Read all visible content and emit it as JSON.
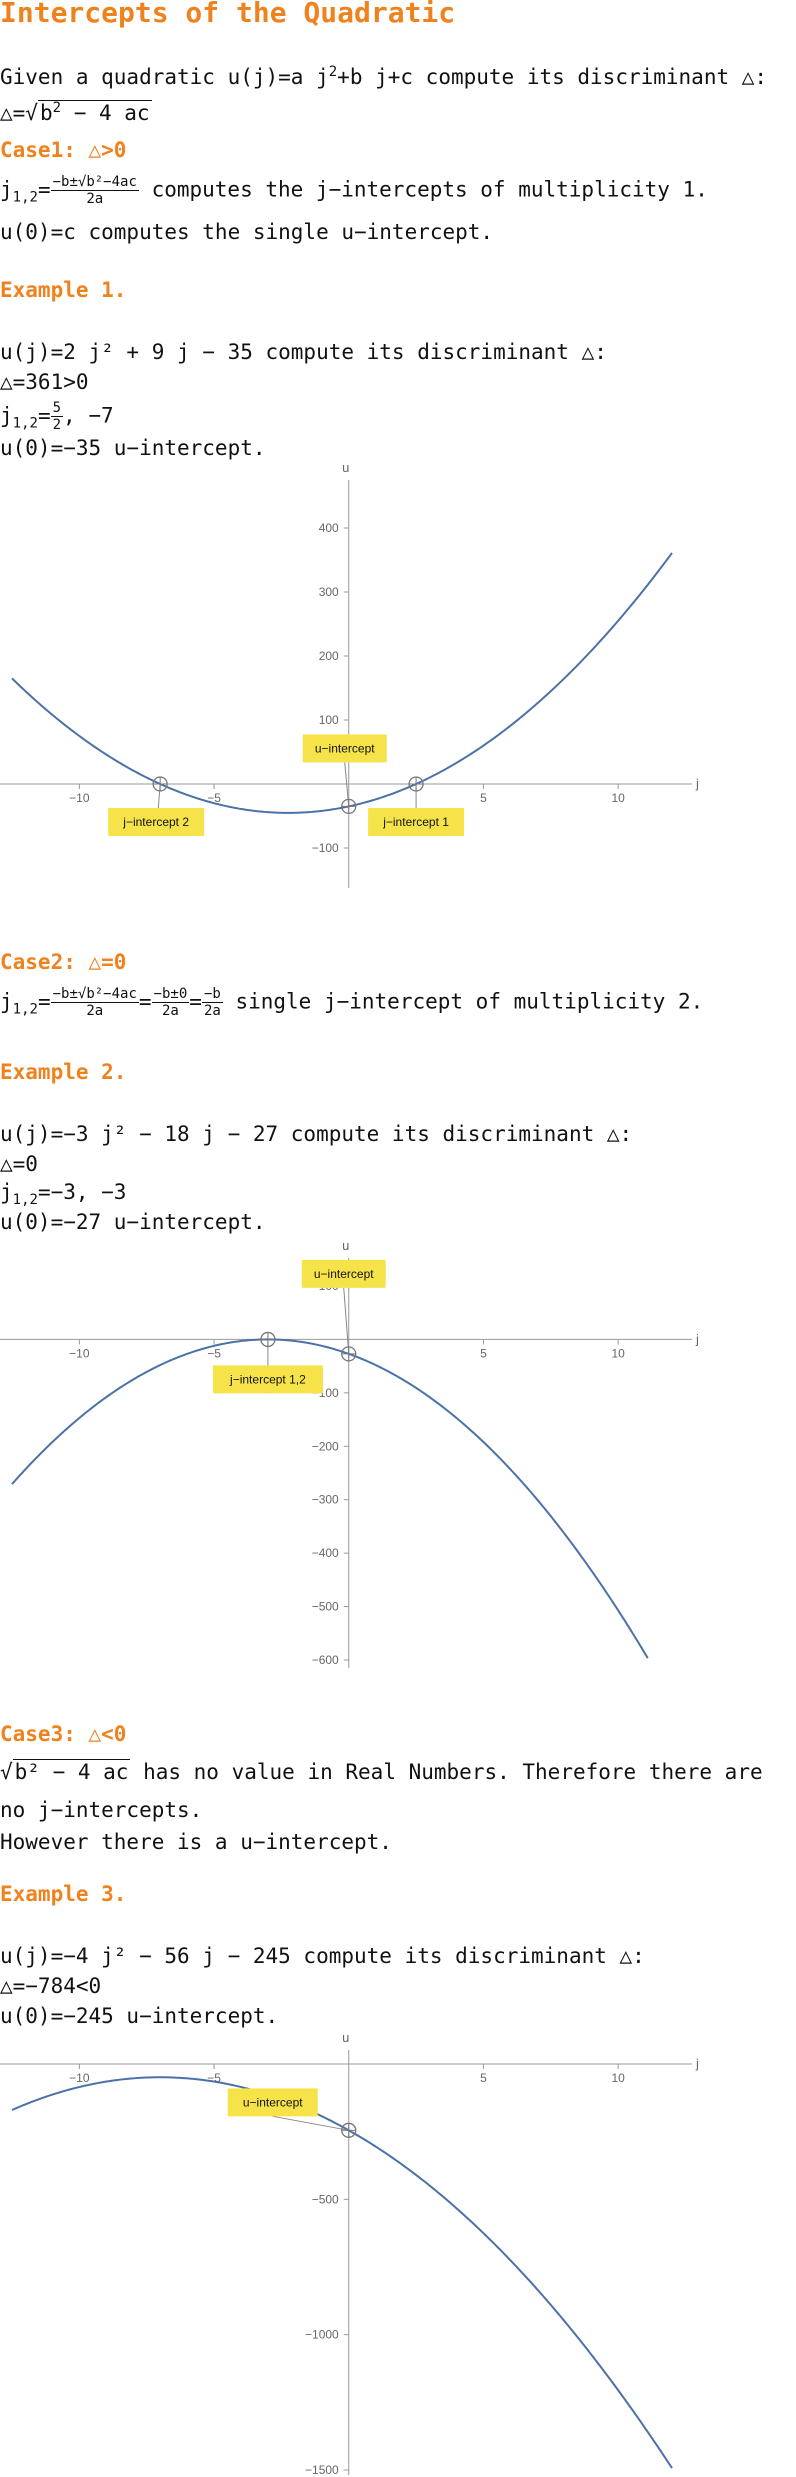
{
  "title": "Intercepts of the Quadratic",
  "intro": {
    "text_a": "Given a quadratic u(j)=a j",
    "exp": "2",
    "text_b": "+b j+c compute its discriminant △:",
    "disc_lhs": "△=",
    "disc_radical": "b",
    "disc_rest": " − 4 ac"
  },
  "case1": {
    "heading": "Case1: △>0",
    "j_label": "j",
    "j_sub": "1,2",
    "eq": "=",
    "num": "−b±√b²−4ac",
    "den": "2a",
    "text1": "computes the j−intercepts of multiplicity 1.",
    "text2": "u(0)=c computes the single u−intercept."
  },
  "example1": {
    "heading": "Example 1.",
    "fn": "u(j)=2 j² + 9 j − 35 compute its discriminant △:",
    "disc": "△=361>0",
    "roots_lhs": "j",
    "roots_sub": "1,2",
    "roots_num": "5",
    "roots_den": "2",
    "roots_tail": ", −7",
    "uint": "u(0)=−35  u−intercept."
  },
  "case2": {
    "heading": "Case2: △=0",
    "j_label": "j",
    "j_sub": "1,2",
    "f1_num": "−b±√b²−4ac",
    "f1_den": "2a",
    "f2_num": "−b±0",
    "f2_den": "2a",
    "f3_num": "−b",
    "f3_den": "2a",
    "text": "single j−intercept of multiplicity 2."
  },
  "example2": {
    "heading": "Example 2.",
    "fn": "u(j)=−3 j² − 18 j − 27 compute its discriminant △:",
    "disc": "△=0",
    "roots_lhs": "j",
    "roots_sub": "1,2",
    "roots_val": "=−3, −3",
    "uint": "u(0)=−27  u−intercept."
  },
  "case3": {
    "heading": "Case3: △<0",
    "radical": "b² − 4 ac",
    "text1": " has no value in Real Numbers. Therefore there are",
    "text2": "no j−intercepts.",
    "text3": "However there is a u−intercept."
  },
  "example3": {
    "heading": "Example 3.",
    "fn": "u(j)=−4 j² − 56 j − 245 compute its discriminant △:",
    "disc": "△=−784<0",
    "uint": "u(0)=−245 u−intercept."
  },
  "chart_data": [
    {
      "type": "line",
      "title": "",
      "xlabel": "j",
      "ylabel": "u",
      "function": {
        "a": 2,
        "b": 9,
        "c": -35
      },
      "xlim": [
        -12.5,
        12
      ],
      "ylim": [
        -150,
        450
      ],
      "xticks": [
        -10,
        -5,
        5,
        10
      ],
      "yticks": [
        -100,
        100,
        200,
        300,
        400
      ],
      "tick_labels_x": [
        "−10",
        "−5",
        "5",
        "10"
      ],
      "tick_labels_y": [
        "−100",
        "100",
        "200",
        "300",
        "400"
      ],
      "points": [
        {
          "x": -7,
          "y": 0
        },
        {
          "x": 2.5,
          "y": 0
        },
        {
          "x": 0,
          "y": -35
        }
      ],
      "annotations": [
        "j−intercept 2",
        "j−intercept 1",
        "u−intercept"
      ],
      "grid": false,
      "line_color": "#4a72a8",
      "label_color": "#f6e34a"
    },
    {
      "type": "line",
      "title": "",
      "xlabel": "j",
      "ylabel": "u",
      "function": {
        "a": -3,
        "b": -18,
        "c": -27
      },
      "xlim": [
        -12.5,
        12
      ],
      "ylim": [
        -600,
        100
      ],
      "xticks": [
        -10,
        -5,
        5,
        10
      ],
      "yticks": [
        -600,
        -500,
        -400,
        -300,
        -200,
        -100,
        100
      ],
      "tick_labels_x": [
        "−10",
        "−5",
        "5",
        "10"
      ],
      "tick_labels_y": [
        "−600",
        "−500",
        "−400",
        "−300",
        "−200",
        "−100",
        "100"
      ],
      "points": [
        {
          "x": -3,
          "y": 0
        },
        {
          "x": 0,
          "y": -27
        }
      ],
      "annotations": [
        "j−intercept 1,2",
        "u−intercept"
      ],
      "grid": false,
      "line_color": "#4a72a8",
      "label_color": "#f6e34a"
    },
    {
      "type": "line",
      "title": "",
      "xlabel": "j",
      "ylabel": "u",
      "function": {
        "a": -4,
        "b": -56,
        "c": -245
      },
      "xlim": [
        -12.5,
        12
      ],
      "ylim": [
        -1500,
        0
      ],
      "xticks": [
        -10,
        -5,
        5,
        10
      ],
      "yticks": [
        -1500,
        -1000,
        -500
      ],
      "tick_labels_x": [
        "−10",
        "−5",
        "5",
        "10"
      ],
      "tick_labels_y": [
        "−1500",
        "−1000",
        "−500"
      ],
      "points": [
        {
          "x": 0,
          "y": -245
        }
      ],
      "annotations": [
        "u−intercept"
      ],
      "grid": false,
      "line_color": "#4a72a8",
      "label_color": "#f6e34a"
    }
  ]
}
